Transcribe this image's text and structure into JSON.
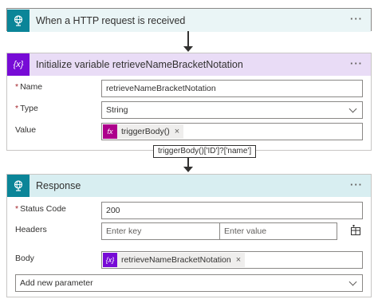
{
  "trigger": {
    "title": "When a HTTP request is received",
    "icon": "http-globe-icon",
    "color": "#0b8598",
    "more": "···"
  },
  "init_variable": {
    "title": "Initialize variable retrieveNameBracketNotation",
    "icon_text": "{x}",
    "color": "#770bd6",
    "more": "···",
    "fields": {
      "name_label": "Name",
      "name_value": "retrieveNameBracketNotation",
      "type_label": "Type",
      "type_value": "String",
      "value_label": "Value",
      "value_token": "triggerBody()",
      "value_token_icon": "fx",
      "value_token_color": "#ad008c"
    },
    "tooltip": "triggerBody()['ID']?['name']"
  },
  "response": {
    "title": "Response",
    "icon": "http-globe-icon",
    "color": "#0b8598",
    "more": "···",
    "fields": {
      "status_label": "Status Code",
      "status_value": "200",
      "headers_label": "Headers",
      "header_key_placeholder": "Enter key",
      "header_value_placeholder": "Enter value",
      "body_label": "Body",
      "body_token": "retrieveNameBracketNotation",
      "body_token_icon": "{x}",
      "body_token_color": "#770bd6",
      "add_param_label": "Add new parameter"
    }
  },
  "required_marker": "*",
  "remove_marker": "×"
}
